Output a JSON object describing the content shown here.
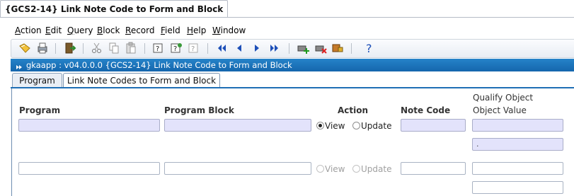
{
  "window_tab": {
    "title": "{GCS2-14} Link Note Code to Form and Block"
  },
  "menu": [
    "Action",
    "Edit",
    "Query",
    "Block",
    "Record",
    "Field",
    "Help",
    "Window"
  ],
  "toolbar": {
    "icons": [
      "save-icon",
      "print-icon",
      "exit-icon",
      "cut-icon",
      "copy-icon",
      "paste-icon",
      "enter-query-icon",
      "execute-query-icon",
      "cancel-query-icon",
      "first-record-icon",
      "previous-record-icon",
      "next-record-icon",
      "last-record-icon",
      "insert-record-icon",
      "remove-record-icon",
      "lock-record-icon",
      "help-icon"
    ]
  },
  "form_title": "gkaapp : v04.0.0.0  {GCS2-14} Link Note Code to  Form and Block",
  "tabs": [
    {
      "label": "Program",
      "active": false
    },
    {
      "label": "Link Note Codes to Form and Block",
      "active": true
    }
  ],
  "columns": {
    "program": "Program",
    "program_block": "Program Block",
    "action": "Action",
    "note_code": "Note Code",
    "qualify_object": "Qualify Object",
    "object_value": "Object Value"
  },
  "rows": [
    {
      "program": "",
      "program_block": "",
      "note_code": "",
      "qualify_object": "",
      "object_value": ".",
      "action": {
        "selected": "View",
        "options": [
          "View",
          "Update"
        ],
        "enabled": true
      }
    },
    {
      "program": "",
      "program_block": "",
      "note_code": "",
      "qualify_object": "",
      "object_value": "",
      "action": {
        "selected": "",
        "options": [
          "View",
          "Update"
        ],
        "enabled": false
      }
    }
  ],
  "colors": {
    "title_bar": "#1a6eb5",
    "highlight_field": "#e3e3fb",
    "accent": "#1f6fb5"
  }
}
